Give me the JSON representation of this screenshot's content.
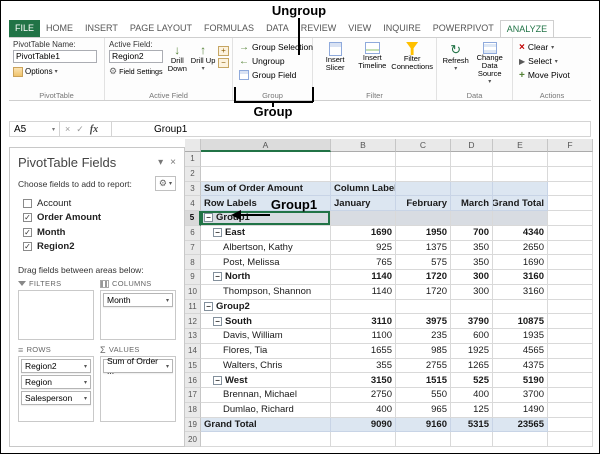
{
  "icons": {
    "dropdown": "▾",
    "check": "✓",
    "close": "×",
    "pane_options": "▾",
    "gear": "⚙",
    "collapse": "−",
    "plus": "+",
    "minus": "−",
    "cancel": "×",
    "enter": "✓",
    "drill_down": "↓",
    "drill_up": "↑",
    "group_selection": "→",
    "ungroup": "←",
    "refresh": "↻",
    "select": "▶",
    "clear": "×",
    "move": "+",
    "sigma": "Σ",
    "rows": "≡"
  },
  "annotations": {
    "ungroup": "Ungroup",
    "group": "Group",
    "group1": "Group1"
  },
  "ribbon": {
    "tabs": [
      {
        "label": "FILE",
        "variant": "file"
      },
      {
        "label": "HOME",
        "variant": ""
      },
      {
        "label": "INSERT",
        "variant": ""
      },
      {
        "label": "PAGE LAYOUT",
        "variant": ""
      },
      {
        "label": "FORMULAS",
        "variant": ""
      },
      {
        "label": "DATA",
        "variant": ""
      },
      {
        "label": "REVIEW",
        "variant": ""
      },
      {
        "label": "VIEW",
        "variant": ""
      },
      {
        "label": "INQUIRE",
        "variant": ""
      },
      {
        "label": "POWERPIVOT",
        "variant": ""
      },
      {
        "label": "ANALYZE",
        "variant": "active"
      }
    ],
    "pivottable": {
      "name_label": "PivotTable Name:",
      "name_value": "PivotTable1",
      "options_label": "Options",
      "group_label": "PivotTable"
    },
    "active_field": {
      "title": "Active Field:",
      "value": "Region2",
      "field_settings": "Field Settings",
      "drill_down": "Drill Down",
      "drill_up": "Drill Up",
      "group_label": "Active Field"
    },
    "group": {
      "items": [
        "Group Selection",
        "Ungroup",
        "Group Field"
      ],
      "group_label": "Group"
    },
    "filter": {
      "items": [
        "Insert Slicer",
        "Insert Timeline",
        "Filter Connections"
      ],
      "group_label": "Filter"
    },
    "data": {
      "refresh": "Refresh",
      "change_source": "Change Data Source",
      "group_label": "Data"
    },
    "actions": {
      "items": [
        "Clear",
        "Select",
        "Move Pivot"
      ],
      "group_label": "Actions"
    }
  },
  "formula_bar": {
    "name_box": "A5",
    "fx": "fx",
    "content": "Group1"
  },
  "fields_panel": {
    "title": "PivotTable Fields",
    "choose_label": "Choose fields to add to report:",
    "fields": [
      {
        "label": "Account",
        "checked": false
      },
      {
        "label": "Order Amount",
        "checked": true
      },
      {
        "label": "Month",
        "checked": true
      },
      {
        "label": "Region2",
        "checked": true
      }
    ],
    "drag_label": "Drag fields between areas below:",
    "areas": [
      {
        "label": "FILTERS",
        "items": []
      },
      {
        "label": "COLUMNS",
        "items": [
          "Month"
        ]
      },
      {
        "label": "ROWS",
        "items": [
          "Region2",
          "Region",
          "Salesperson"
        ]
      },
      {
        "label": "VALUES",
        "items": [
          "Sum of Order ..."
        ]
      }
    ]
  },
  "sheet": {
    "col_headers": [
      "A",
      "B",
      "C",
      "D",
      "E",
      "F"
    ],
    "rows": [
      {
        "n": "1"
      },
      {
        "n": "2"
      },
      {
        "n": "3",
        "label": "Sum of Order Amount",
        "v1": "Column Labels",
        "dd": true,
        "bg": "blue",
        "bold": true,
        "v1l": true
      },
      {
        "n": "4",
        "label": "Row Labels",
        "v1": "January",
        "v2": "February",
        "v3": "March",
        "v4": "Grand Total",
        "bg": "blue",
        "bold": true,
        "v1l": true
      },
      {
        "n": "5",
        "label": "Group1",
        "collapse": true,
        "bold": true,
        "bg": "sel",
        "sel": true
      },
      {
        "n": "6",
        "label": "East",
        "collapse": true,
        "ind": 1,
        "bold": true,
        "v1": "1690",
        "v2": "1950",
        "v3": "700",
        "v4": "4340"
      },
      {
        "n": "7",
        "label": "Albertson, Kathy",
        "ind": 2,
        "v1": "925",
        "v2": "1375",
        "v3": "350",
        "v4": "2650"
      },
      {
        "n": "8",
        "label": "Post, Melissa",
        "ind": 2,
        "v1": "765",
        "v2": "575",
        "v3": "350",
        "v4": "1690"
      },
      {
        "n": "9",
        "label": "North",
        "collapse": true,
        "ind": 1,
        "bold": true,
        "v1": "1140",
        "v2": "1720",
        "v3": "300",
        "v4": "3160"
      },
      {
        "n": "10",
        "label": "Thompson, Shannon",
        "ind": 2,
        "v1": "1140",
        "v2": "1720",
        "v3": "300",
        "v4": "3160"
      },
      {
        "n": "11",
        "label": "Group2",
        "collapse": true,
        "bold": true
      },
      {
        "n": "12",
        "label": "South",
        "collapse": true,
        "ind": 1,
        "bold": true,
        "v1": "3110",
        "v2": "3975",
        "v3": "3790",
        "v4": "10875"
      },
      {
        "n": "13",
        "label": "Davis, William",
        "ind": 2,
        "v1": "1100",
        "v2": "235",
        "v3": "600",
        "v4": "1935"
      },
      {
        "n": "14",
        "label": "Flores, Tia",
        "ind": 2,
        "v1": "1655",
        "v2": "985",
        "v3": "1925",
        "v4": "4565"
      },
      {
        "n": "15",
        "label": "Walters, Chris",
        "ind": 2,
        "v1": "355",
        "v2": "2755",
        "v3": "1265",
        "v4": "4375"
      },
      {
        "n": "16",
        "label": "West",
        "collapse": true,
        "ind": 1,
        "bold": true,
        "v1": "3150",
        "v2": "1515",
        "v3": "525",
        "v4": "5190"
      },
      {
        "n": "17",
        "label": "Brennan, Michael",
        "ind": 2,
        "v1": "2750",
        "v2": "550",
        "v3": "400",
        "v4": "3700"
      },
      {
        "n": "18",
        "label": "Dumlao, Richard",
        "ind": 2,
        "v1": "400",
        "v2": "965",
        "v3": "125",
        "v4": "1490"
      },
      {
        "n": "19",
        "label": "Grand Total",
        "bold": true,
        "bg": "blue",
        "v1": "9090",
        "v2": "9160",
        "v3": "5315",
        "v4": "23565"
      },
      {
        "n": "20"
      }
    ]
  },
  "colors": {
    "excel_green": "#217346",
    "header_fill": "#dce6f1"
  }
}
